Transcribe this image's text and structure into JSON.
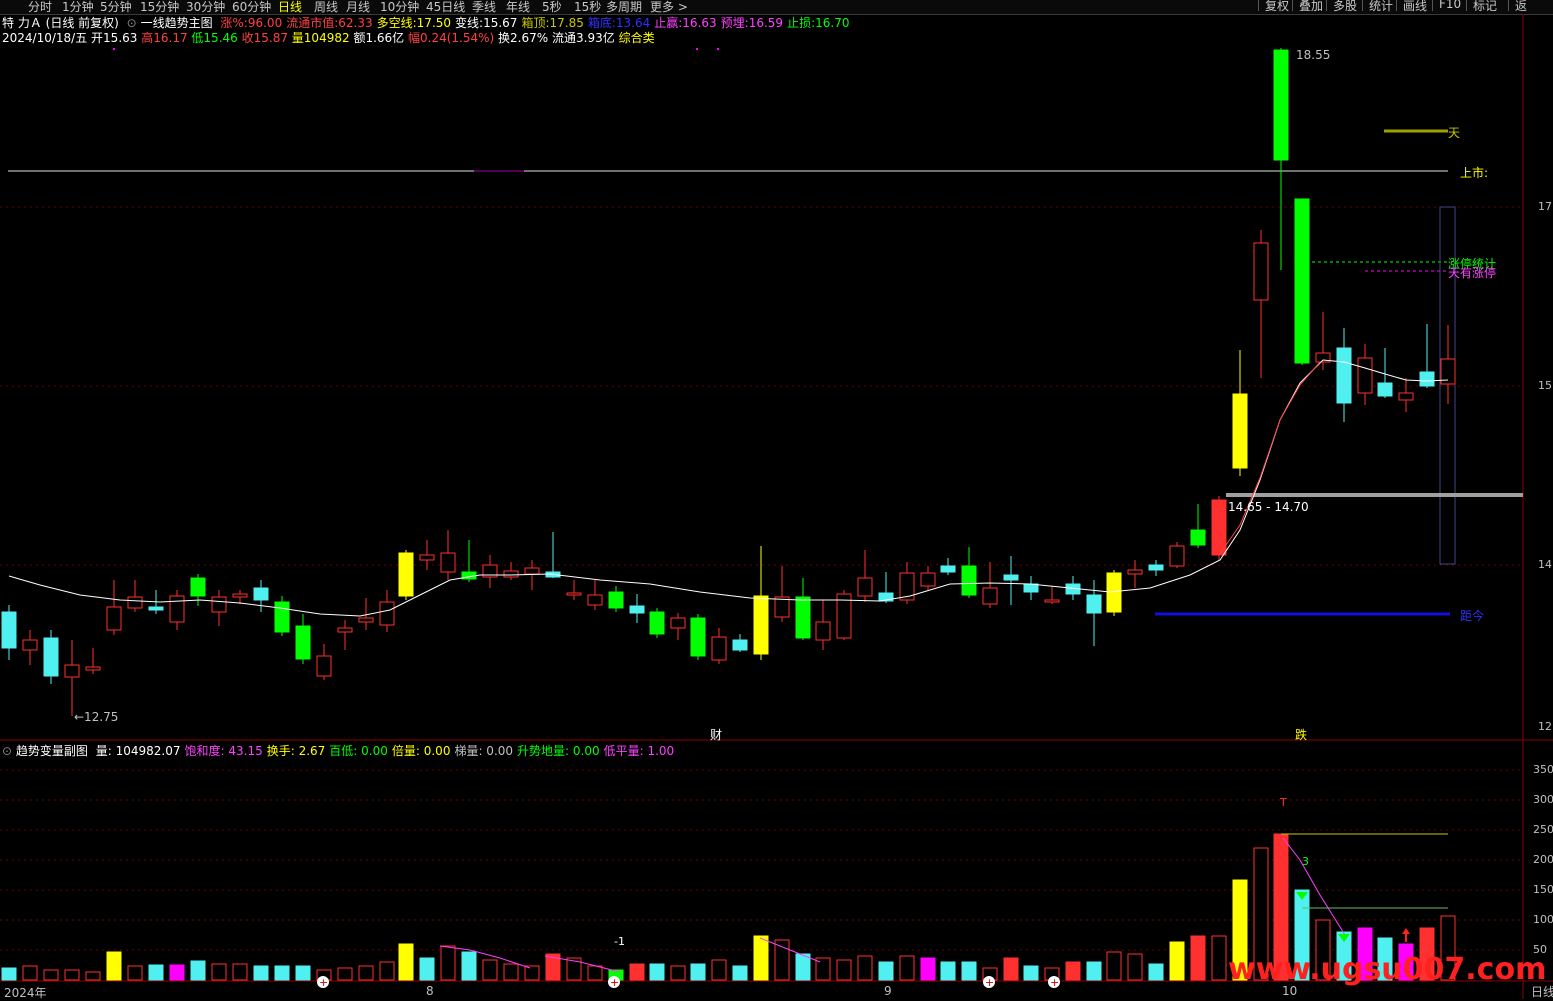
{
  "toolbar": {
    "tabs": [
      "分时",
      "1分钟",
      "5分钟",
      "15分钟",
      "30分钟",
      "60分钟",
      "日线",
      "周线",
      "月线",
      "10分钟",
      "45日线",
      "季线",
      "年线",
      "5秒",
      "15秒",
      "多周期",
      "更多 >"
    ],
    "active_tab": "日线",
    "right_buttons": [
      "复权",
      "叠加",
      "多股",
      "统计",
      "画线",
      "F10",
      "标记",
      "返"
    ]
  },
  "header": {
    "stock_name": "特 力Ａ",
    "period": "(日线 前复权)",
    "indicator_name": "一线趋势主图",
    "fields": [
      {
        "label": "涨%:",
        "value": "96.00",
        "color": "#ff4040"
      },
      {
        "label": "流通市值:",
        "value": "62.33",
        "color": "#ff4040"
      },
      {
        "label": "多空线:",
        "value": "17.50",
        "color": "#ffff00"
      },
      {
        "label": "变线:",
        "value": "15.67",
        "color": "#ffffff"
      },
      {
        "label": "箱顶:",
        "value": "17.85",
        "color": "#c8c800"
      },
      {
        "label": "箱底:",
        "value": "13.64",
        "color": "#3030ff"
      },
      {
        "label": "止赢:",
        "value": "16.63",
        "color": "#ff40ff"
      },
      {
        "label": "预埋:",
        "value": "16.59",
        "color": "#ff40ff"
      },
      {
        "label": "止损:",
        "value": "16.70",
        "color": "#00ff00"
      }
    ]
  },
  "quote": {
    "date": "2024/10/18/五",
    "open": "开15.63",
    "high": "高16.17",
    "low": "低15.46",
    "close": "收15.87",
    "volume": "量104982",
    "amount": "额1.66亿",
    "change": "幅0.24(1.54%)",
    "turnover": "换2.67%",
    "float": "流通3.93亿",
    "category": "综合类"
  },
  "main_chart": {
    "price_axis": [
      "17",
      "15",
      "14",
      "12"
    ],
    "annotations": {
      "peak": "18.55",
      "trough": "←12.75",
      "tian": "天",
      "listing": "上市:",
      "limit_stats": "涨停统计",
      "limit_days": "天有涨停",
      "range": "14.65 - 14.70",
      "distance": "距今",
      "event_cai": "财",
      "event_die": "跌"
    }
  },
  "sub_chart": {
    "name": "趋势变量副图",
    "fields": [
      {
        "label": "量:",
        "value": "104982.07",
        "color": "#ffffff"
      },
      {
        "label": "饱和度:",
        "value": "43.15",
        "color": "#ff40ff"
      },
      {
        "label": "换手:",
        "value": "2.67",
        "color": "#ffff00"
      },
      {
        "label": "百低:",
        "value": "0.00",
        "color": "#00ff00"
      },
      {
        "label": "倍量:",
        "value": "0.00",
        "color": "#ffff00"
      },
      {
        "label": "梯量:",
        "value": "0.00",
        "color": "#c0c0c0"
      },
      {
        "label": "升势地量:",
        "value": "0.00",
        "color": "#00ff00"
      },
      {
        "label": "低平量:",
        "value": "1.00",
        "color": "#ff40ff"
      }
    ],
    "axis": [
      "350",
      "300",
      "250",
      "200",
      "150",
      "100",
      "50"
    ],
    "marks": {
      "t": "T",
      "three": "3",
      "minus_one": "-1"
    }
  },
  "bottom_axis": {
    "year": "2024年",
    "m8": "8",
    "m9": "9",
    "m10": "10",
    "corner": "日线"
  },
  "watermark": "www.ugsu007.com",
  "colors": {
    "up": "#ff3030",
    "down_cyan": "#50f0f0",
    "green": "#00ff00",
    "yellow": "#ffff00",
    "magenta": "#ff00ff",
    "ma": "#ffffff",
    "grid": "#6a0000"
  }
}
